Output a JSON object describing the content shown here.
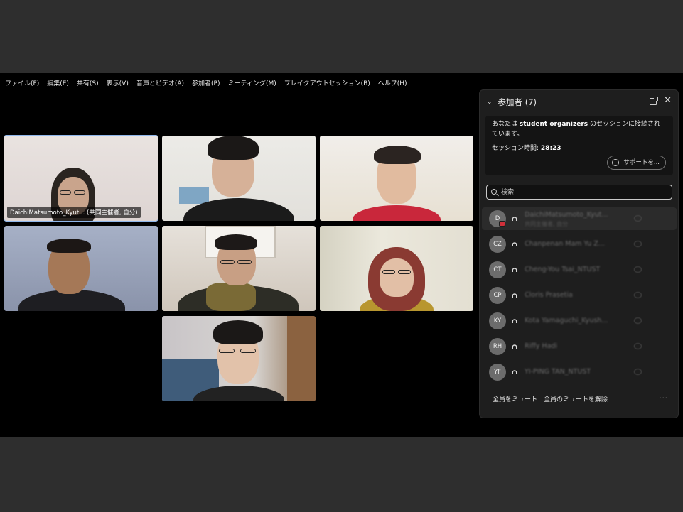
{
  "menu": [
    "ファイル(F)",
    "編集(E)",
    "共有(S)",
    "表示(V)",
    "音声とビデオ(A)",
    "参加者(P)",
    "ミーティング(M)",
    "ブレイクアウトセッション(B)",
    "ヘルプ(H)"
  ],
  "video_tiles": [
    {
      "label": "DaichiMatsumoto_Kyut... (共同主催者, 自分)",
      "active": true
    },
    {
      "label": "",
      "active": false
    },
    {
      "label": "",
      "active": false
    },
    {
      "label": "",
      "active": false
    },
    {
      "label": "",
      "active": false
    },
    {
      "label": "",
      "active": false
    },
    {
      "label": "",
      "active": false
    }
  ],
  "panel": {
    "title": "参加者 (7)",
    "session_prefix": "あなたは",
    "session_name": "student organizers",
    "session_suffix": " のセッションに接続されています。",
    "session_time_label": "セッション時間:",
    "session_time": "28:23",
    "support_label": "サポートを...",
    "search_placeholder": "検索",
    "participants": [
      {
        "initials": "D",
        "name": "DaichiMatsumoto_Kyut...",
        "role": "共同主催者, 自分"
      },
      {
        "initials": "CZ",
        "name": "Chanpenan Mam Yu Z..."
      },
      {
        "initials": "CT",
        "name": "Cheng-You Tsai_NTUST"
      },
      {
        "initials": "CP",
        "name": "Cloris Prasetia"
      },
      {
        "initials": "KY",
        "name": "Kota Yamaguchi_Kyush..."
      },
      {
        "initials": "RH",
        "name": "Riffy Hadi"
      },
      {
        "initials": "YF",
        "name": "YI-PING TAN_NTUST"
      }
    ],
    "mute_all": "全員をミュート",
    "unmute_all": "全員のミュートを解除",
    "more": "..."
  }
}
